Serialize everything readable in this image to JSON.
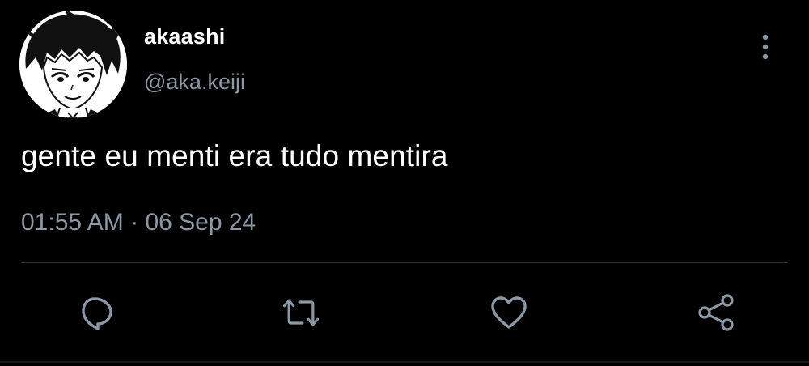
{
  "user": {
    "display_name": "akaashi",
    "handle": "@aka.keiji",
    "avatar_icon": "anime-character-avatar"
  },
  "tweet": {
    "text": "gente eu menti era tudo mentira",
    "time": "01:55 AM",
    "separator": "·",
    "date": "06 Sep 24"
  },
  "actions": {
    "reply_icon": "reply-icon",
    "retweet_icon": "retweet-icon",
    "like_icon": "heart-icon",
    "share_icon": "share-icon"
  },
  "colors": {
    "background": "#000000",
    "primary_text": "#ffffff",
    "secondary_text": "#8b98a5",
    "divider": "#2f3336"
  }
}
